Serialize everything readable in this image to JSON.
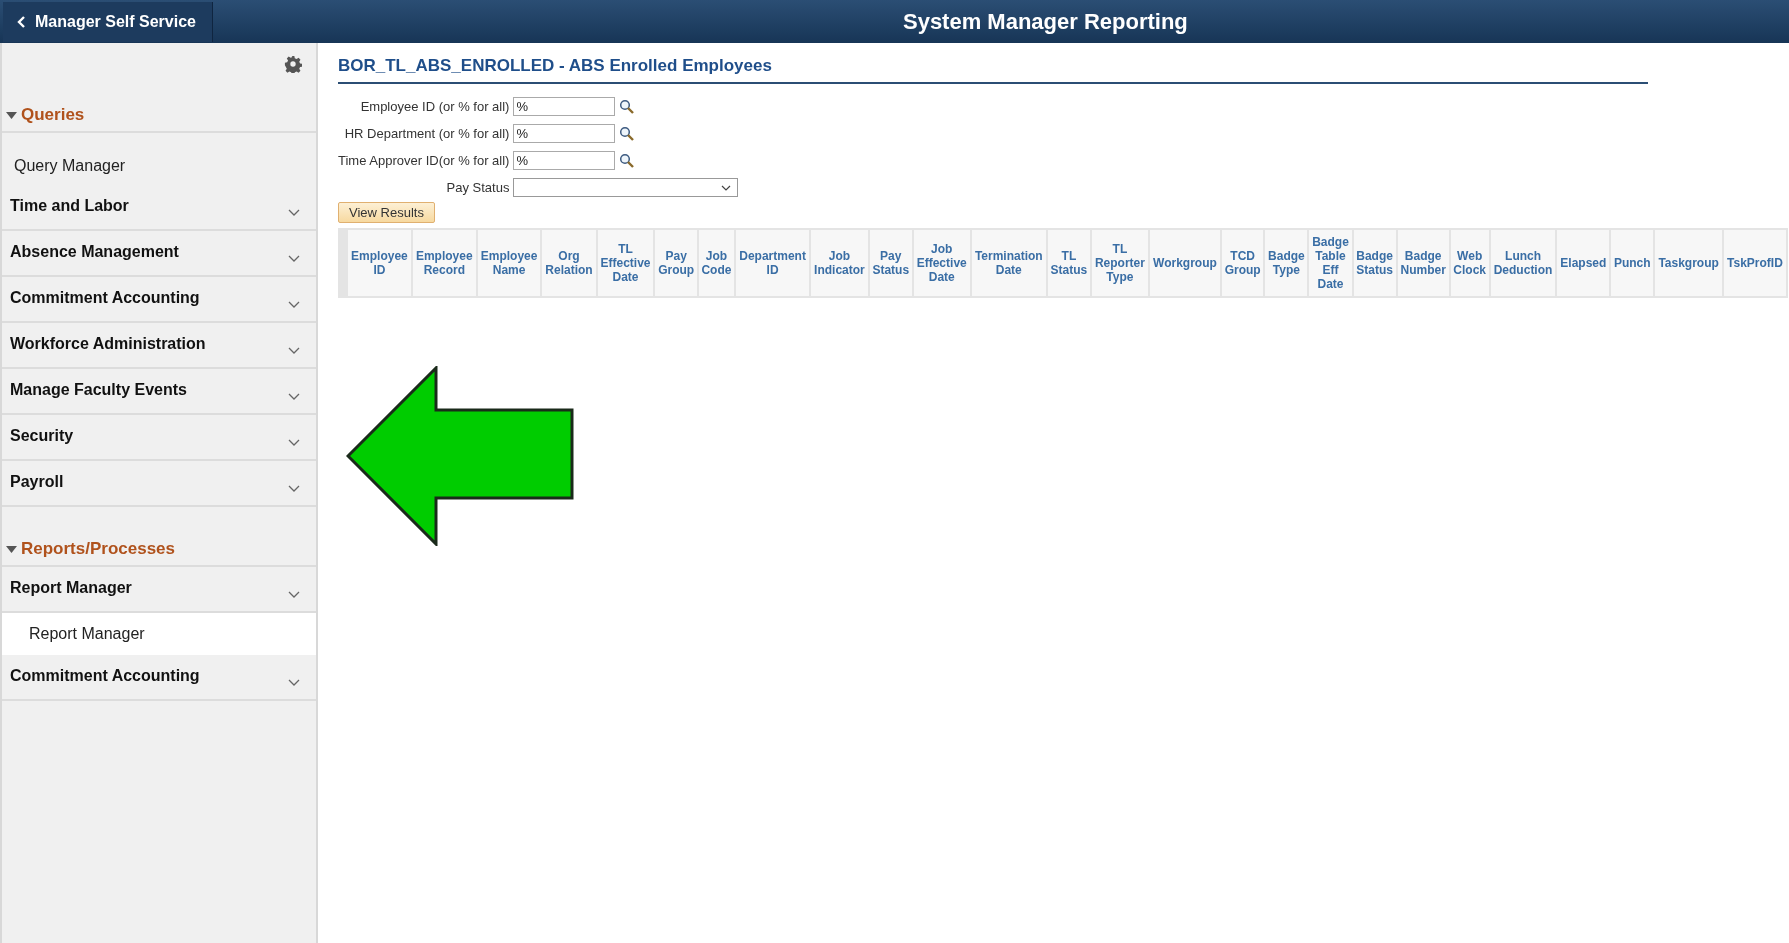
{
  "header": {
    "back_button": "Manager Self Service",
    "title": "System Manager Reporting"
  },
  "sidebar": {
    "sections": [
      {
        "title": "Queries",
        "expanded": true,
        "items": [
          {
            "kind": "link",
            "label": "Query Manager"
          },
          {
            "kind": "folder",
            "label": "Time and Labor"
          },
          {
            "kind": "folder",
            "label": "Absence Management"
          },
          {
            "kind": "folder",
            "label": "Commitment Accounting"
          },
          {
            "kind": "folder",
            "label": "Workforce Administration"
          },
          {
            "kind": "folder",
            "label": "Manage Faculty Events"
          },
          {
            "kind": "folder",
            "label": "Security"
          },
          {
            "kind": "folder",
            "label": "Payroll"
          }
        ]
      },
      {
        "title": "Reports/Processes",
        "expanded": true,
        "items": [
          {
            "kind": "folder",
            "label": "Report Manager",
            "children": [
              {
                "label": "Report Manager"
              }
            ]
          },
          {
            "kind": "folder",
            "label": "Commitment Accounting"
          }
        ]
      }
    ]
  },
  "page_title": "BOR_TL_ABS_ENROLLED - ABS Enrolled Employees",
  "prompts": [
    {
      "kind": "text",
      "label": "Employee ID (or % for all)",
      "value": "%"
    },
    {
      "kind": "text",
      "label": "HR Department (or % for all)",
      "value": "%"
    },
    {
      "kind": "text",
      "label": "Time Approver ID(or % for all)",
      "value": "%"
    },
    {
      "kind": "select",
      "label": "Pay Status"
    }
  ],
  "view_button": "View Results",
  "table": {
    "columns": [
      "Employee\nID",
      "Employee\nRecord",
      "Employee\nName",
      "Org\nRelation",
      "TL\nEffective\nDate",
      "Pay\nGroup",
      "Job\nCode",
      "Department\nID",
      "Job\nIndicator",
      "Pay\nStatus",
      "Job\nEffective\nDate",
      "Termination\nDate",
      "TL\nStatus",
      "TL\nReporter\nType",
      "Workgroup",
      "TCD\nGroup",
      "Badge\nType",
      "Badge\nTable\nEff\nDate",
      "Badge\nStatus",
      "Badge\nNumber",
      "Web\nClock",
      "Lunch\nDeduction",
      "Elapsed",
      "Punch",
      "Taskgroup",
      "TskProfID"
    ]
  }
}
